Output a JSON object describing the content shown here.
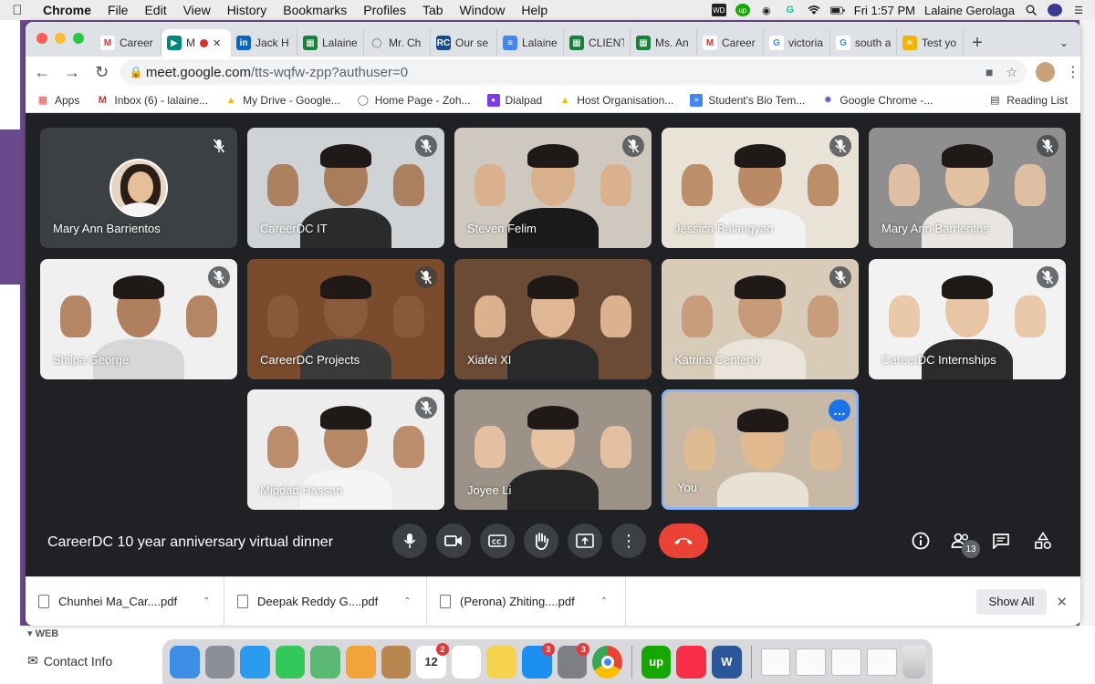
{
  "menubar": {
    "app": "Chrome",
    "items": [
      "File",
      "Edit",
      "View",
      "History",
      "Bookmarks",
      "Profiles",
      "Tab",
      "Window",
      "Help"
    ],
    "clock": "Fri 1:57 PM",
    "user": "Lalaine Gerolaga"
  },
  "browser": {
    "tabs": [
      {
        "label": "Career",
        "icon": "gmail-icon",
        "color": "#ffffff"
      },
      {
        "label": "M",
        "icon": "meet-icon",
        "color": "#00897b",
        "active": true
      },
      {
        "label": "Jack H",
        "icon": "linkedin-icon",
        "color": "#0a66c2"
      },
      {
        "label": "Lalaine",
        "icon": "sheets-icon",
        "color": "#188038"
      },
      {
        "label": "Mr. Ch",
        "icon": "link-icon",
        "color": "#5f6368"
      },
      {
        "label": "Our se",
        "icon": "rc-icon",
        "color": "#1a4b8c"
      },
      {
        "label": "Lalaine",
        "icon": "docs-icon",
        "color": "#4285f4"
      },
      {
        "label": "CLIENT",
        "icon": "sheets-icon",
        "color": "#188038"
      },
      {
        "label": "Ms. An",
        "icon": "sheets-icon",
        "color": "#188038"
      },
      {
        "label": "Career",
        "icon": "gmail-icon",
        "color": "#ffffff"
      },
      {
        "label": "victoria",
        "icon": "google-icon",
        "color": "#ffffff"
      },
      {
        "label": "south a",
        "icon": "google-icon",
        "color": "#ffffff"
      },
      {
        "label": "Test yo",
        "icon": "sun-icon",
        "color": "#f4b400"
      }
    ],
    "url_host": "meet.google.com",
    "url_path": "/tts-wqfw-zpp?authuser=0",
    "bookmarks": [
      {
        "label": "Apps",
        "icon": "apps-grid-icon"
      },
      {
        "label": "Inbox (6) - lalaine...",
        "icon": "gmail-icon"
      },
      {
        "label": "My Drive - Google...",
        "icon": "drive-icon"
      },
      {
        "label": "Home Page - Zoh...",
        "icon": "zoho-icon"
      },
      {
        "label": "Dialpad",
        "icon": "dialpad-icon"
      },
      {
        "label": "Host Organisation...",
        "icon": "drive-icon"
      },
      {
        "label": "Student's Bio Tem...",
        "icon": "docs-icon"
      },
      {
        "label": "Google Chrome -...",
        "icon": "chrome-gear-icon"
      }
    ],
    "reading_list": "Reading List"
  },
  "meet": {
    "participants": [
      {
        "name": "Mary Ann Barrientos",
        "bg": "#3c4043",
        "avatar": true,
        "muted": true
      },
      {
        "name": "CareerDC IT",
        "bg": "#cfd3d6",
        "skin": "#a97c5c",
        "shirt": "#2b2b2b",
        "muted": true
      },
      {
        "name": "Steven Felim",
        "bg": "#cfc8bf",
        "skin": "#d9b08c",
        "shirt": "#1a1a1a",
        "muted": true
      },
      {
        "name": "Jessica Balangyao",
        "bg": "#e8e2d7",
        "skin": "#b98a65",
        "shirt": "#f2f2f2",
        "muted": true
      },
      {
        "name": "Mary Ann Barrientos",
        "bg": "#8f8f8f",
        "skin": "#e3c2a4",
        "shirt": "#e9e6e1",
        "muted": true
      },
      {
        "name": "Shilpa George",
        "bg": "#f0f0f0",
        "skin": "#b07f5e",
        "shirt": "#d7d7d7",
        "muted": true
      },
      {
        "name": "CareerDC Projects",
        "bg": "#7a4b2c",
        "skin": "#8a5a3c",
        "shirt": "#3a3a3a",
        "muted": true
      },
      {
        "name": "Xiafei XI",
        "bg": "#6b4a36",
        "skin": "#e0b794",
        "shirt": "#2a2a2a",
        "muted": false
      },
      {
        "name": "Katrina Centeno",
        "bg": "#d8cbb7",
        "skin": "#c69a78",
        "shirt": "#eae4db",
        "muted": true
      },
      {
        "name": "CareerDC Internships",
        "bg": "#f2f2f2",
        "skin": "#e8c6a5",
        "shirt": "#2c2c2c",
        "muted": true
      },
      {
        "name": "Miqdad Hassan",
        "bg": "#ededed",
        "skin": "#b88866",
        "shirt": "#f5f5f5",
        "muted": true
      },
      {
        "name": "Joyee Li",
        "bg": "#9c9287",
        "skin": "#e7c3a2",
        "shirt": "#262626",
        "muted": false
      },
      {
        "name": "You",
        "bg": "#c8b9a6",
        "skin": "#e2b98f",
        "shirt": "#e9e1d4",
        "muted": false,
        "self": true
      }
    ],
    "meeting_title": "CareerDC 10 year anniversary virtual dinner",
    "people_count": "13",
    "colors": {
      "bg": "#202124",
      "control": "#3c4043",
      "hangup": "#ea4335",
      "self_border": "#8ab4f8"
    }
  },
  "downloads": {
    "items": [
      "Chunhei Ma_Car....pdf",
      "Deepak Reddy G....pdf",
      "(Perona) Zhiting....pdf"
    ],
    "show_all": "Show All"
  },
  "background": {
    "section": "WEB",
    "contact": "Contact Info"
  },
  "dock": {
    "apps": [
      {
        "name": "finder-icon",
        "color": "#3d8fe6"
      },
      {
        "name": "launchpad-icon",
        "color": "#8a8f98"
      },
      {
        "name": "safari-icon",
        "color": "#2a9cf0"
      },
      {
        "name": "facetime-icon",
        "color": "#34c759"
      },
      {
        "name": "maps-icon",
        "color": "#5bb974"
      },
      {
        "name": "photos-icon",
        "color": "#f2a33a"
      },
      {
        "name": "contacts-icon",
        "color": "#b8874f"
      },
      {
        "name": "calendar-icon",
        "color": "#ffffff",
        "text": "12",
        "badge": "2"
      },
      {
        "name": "reminders-icon",
        "color": "#ffffff"
      },
      {
        "name": "notes-icon",
        "color": "#f6d34c"
      },
      {
        "name": "appstore-icon",
        "color": "#1b8ef2",
        "badge": "3"
      },
      {
        "name": "system-preferences-icon",
        "color": "#7d7f85",
        "badge": "3"
      },
      {
        "name": "chrome-icon",
        "color": "#ffffff"
      },
      {
        "name": "upwork-icon",
        "color": "#14a800",
        "text": "up"
      },
      {
        "name": "music-icon",
        "color": "#fa2d48"
      },
      {
        "name": "word-icon",
        "color": "#2b579a",
        "text": "W"
      }
    ]
  }
}
